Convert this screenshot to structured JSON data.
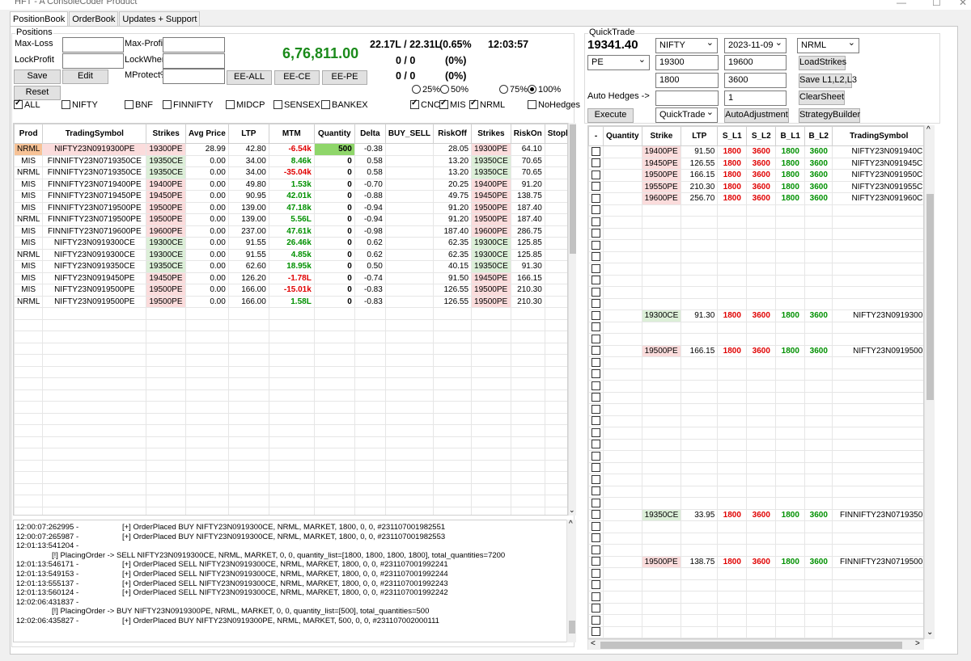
{
  "window": {
    "title": "HFT - A ConsoleCoder Product"
  },
  "tabs": [
    "PositionBook",
    "OrderBook",
    "Updates + Support"
  ],
  "positions": {
    "group_title": "Positions",
    "labels": {
      "max_loss": "Max-Loss",
      "max_profit": "Max-Profit",
      "lock_profit": "LockProfit",
      "lock_when": "LockWhen",
      "mprotect": "MProtect%"
    },
    "buttons": {
      "save": "Save",
      "edit": "Edit",
      "reset": "Reset",
      "ee_all": "EE-ALL",
      "ee_ce": "EE-CE",
      "ee_pe": "EE-PE"
    },
    "pnl": "6,76,811.00",
    "margin": "22.17L / 22.31L",
    "margin_pct": "(0.65%",
    "time": "12:03:57",
    "row1": "0 / 0",
    "row1_pct": "(0%)",
    "row2": "0 / 0",
    "row2_pct": "(0%)",
    "radios": [
      {
        "label": "25%",
        "on": false
      },
      {
        "label": "50%",
        "on": false
      },
      {
        "label": "75%",
        "on": false
      },
      {
        "label": "100%",
        "on": true
      }
    ],
    "filters": [
      {
        "label": "ALL",
        "on": true
      },
      {
        "label": "NIFTY",
        "on": false
      },
      {
        "label": "BNF",
        "on": false
      },
      {
        "label": "FINNIFTY",
        "on": false
      },
      {
        "label": "MIDCP",
        "on": false
      },
      {
        "label": "SENSEX",
        "on": false
      },
      {
        "label": "BANKEX",
        "on": false
      }
    ],
    "types": [
      {
        "label": "CNC",
        "on": true
      },
      {
        "label": "MIS",
        "on": true
      },
      {
        "label": "NRML",
        "on": true
      }
    ],
    "nohedges": {
      "label": "NoHedges",
      "on": false
    },
    "columns": [
      "Prod",
      "TradingSymbol",
      "Strikes",
      "Avg Price",
      "LTP",
      "MTM",
      "Quantity",
      "Delta",
      "BUY_SELL",
      "RiskOff",
      "Strikes",
      "RiskOn",
      "Stoploss"
    ],
    "rows": [
      [
        "NRML",
        "NIFTY23N0919300PE",
        "19300PE",
        "28.99",
        "42.80",
        "-6.54k",
        "500",
        "-0.38",
        "",
        "28.05",
        "19300PE",
        "64.10",
        ""
      ],
      [
        "MIS",
        "FINNIFTY23N0719350CE",
        "19350CE",
        "0.00",
        "34.00",
        "8.46k",
        "0",
        "0.58",
        "",
        "13.20",
        "19350CE",
        "70.65",
        ""
      ],
      [
        "NRML",
        "FINNIFTY23N0719350CE",
        "19350CE",
        "0.00",
        "34.00",
        "-35.04k",
        "0",
        "0.58",
        "",
        "13.20",
        "19350CE",
        "70.65",
        ""
      ],
      [
        "MIS",
        "FINNIFTY23N0719400PE",
        "19400PE",
        "0.00",
        "49.80",
        "1.53k",
        "0",
        "-0.70",
        "",
        "20.25",
        "19400PE",
        "91.20",
        ""
      ],
      [
        "MIS",
        "FINNIFTY23N0719450PE",
        "19450PE",
        "0.00",
        "90.95",
        "42.01k",
        "0",
        "-0.88",
        "",
        "49.75",
        "19450PE",
        "138.75",
        ""
      ],
      [
        "MIS",
        "FINNIFTY23N0719500PE",
        "19500PE",
        "0.00",
        "139.00",
        "47.18k",
        "0",
        "-0.94",
        "",
        "91.20",
        "19500PE",
        "187.40",
        ""
      ],
      [
        "NRML",
        "FINNIFTY23N0719500PE",
        "19500PE",
        "0.00",
        "139.00",
        "5.56L",
        "0",
        "-0.94",
        "",
        "91.20",
        "19500PE",
        "187.40",
        ""
      ],
      [
        "MIS",
        "FINNIFTY23N0719600PE",
        "19600PE",
        "0.00",
        "237.00",
        "47.61k",
        "0",
        "-0.98",
        "",
        "187.40",
        "19600PE",
        "286.75",
        ""
      ],
      [
        "MIS",
        "NIFTY23N0919300CE",
        "19300CE",
        "0.00",
        "91.55",
        "26.46k",
        "0",
        "0.62",
        "",
        "62.35",
        "19300CE",
        "125.85",
        ""
      ],
      [
        "NRML",
        "NIFTY23N0919300CE",
        "19300CE",
        "0.00",
        "91.55",
        "4.85k",
        "0",
        "0.62",
        "",
        "62.35",
        "19300CE",
        "125.85",
        ""
      ],
      [
        "MIS",
        "NIFTY23N0919350CE",
        "19350CE",
        "0.00",
        "62.60",
        "18.95k",
        "0",
        "0.50",
        "",
        "40.15",
        "19350CE",
        "91.30",
        ""
      ],
      [
        "MIS",
        "NIFTY23N0919450PE",
        "19450PE",
        "0.00",
        "126.20",
        "-1.78L",
        "0",
        "-0.74",
        "",
        "91.50",
        "19450PE",
        "166.15",
        ""
      ],
      [
        "MIS",
        "NIFTY23N0919500PE",
        "19500PE",
        "0.00",
        "166.00",
        "-15.01k",
        "0",
        "-0.83",
        "",
        "126.55",
        "19500PE",
        "210.30",
        ""
      ],
      [
        "NRML",
        "NIFTY23N0919500PE",
        "19500PE",
        "0.00",
        "166.00",
        "1.58L",
        "0",
        "-0.83",
        "",
        "126.55",
        "19500PE",
        "210.30",
        ""
      ]
    ],
    "log": [
      [
        "12:00:07:262995 -",
        "[+] OrderPlaced BUY NIFTY23N0919300CE, NRML, MARKET, 1800, 0, 0, #231107001982551"
      ],
      [
        "12:00:07:265987 -",
        "[+] OrderPlaced BUY NIFTY23N0919300CE, NRML, MARKET, 1800, 0, 0, #231107001982553"
      ],
      [
        "12:01:13:541204 -",
        ""
      ],
      [
        "",
        "[!] PlacingOrder -> SELL NIFTY23N0919300CE, NRML, MARKET, 0, 0, quantity_list=[1800, 1800, 1800, 1800], total_quantities=7200"
      ],
      [
        "12:01:13:546171 -",
        "[+] OrderPlaced SELL NIFTY23N0919300CE, NRML, MARKET, 1800, 0, 0, #231107001992241"
      ],
      [
        "12:01:13:549153 -",
        "[+] OrderPlaced SELL NIFTY23N0919300CE, NRML, MARKET, 1800, 0, 0, #231107001992244"
      ],
      [
        "12:01:13:555137 -",
        "[+] OrderPlaced SELL NIFTY23N0919300CE, NRML, MARKET, 1800, 0, 0, #231107001992243"
      ],
      [
        "12:01:13:560124 -",
        "[+] OrderPlaced SELL NIFTY23N0919300CE, NRML, MARKET, 1800, 0, 0, #231107001992242"
      ],
      [
        "12:02:06:431837 -",
        ""
      ],
      [
        "",
        "[!] PlacingOrder -> BUY NIFTY23N0919300PE, NRML, MARKET, 0, 0, quantity_list=[500], total_quantities=500"
      ],
      [
        "12:02:06:435827 -",
        "[+] OrderPlaced BUY NIFTY23N0919300PE, NRML, MARKET, 500, 0, 0, #231107002000111"
      ]
    ]
  },
  "quicktrade": {
    "group_title": "QuickTrade",
    "spot": "19341.40",
    "index": "NIFTY",
    "expiry": "2023-11-09",
    "product": "NRML",
    "opt_type": "PE",
    "from_strike": "19300",
    "to_strike": "19600",
    "qty1": "1800",
    "qty2": "3600",
    "auto_hedges_label": "Auto Hedges ->",
    "auto_hedges_val": "",
    "auto_hedges_num": "1",
    "buttons": {
      "load": "LoadStrikes",
      "save_l": "Save L1,L2,L3",
      "clear": "ClearSheet",
      "execute": "Execute",
      "auto_adj": "AutoAdjustment",
      "strategy": "StrategyBuilder"
    },
    "mode": "QuickTrade",
    "columns": [
      "-",
      "Quantity",
      "Strike",
      "LTP",
      "S_L1",
      "S_L2",
      "B_L1",
      "B_L2",
      "TradingSymbol"
    ],
    "rows": [
      {
        "strike": "19400PE",
        "ltp": "91.50",
        "s1": "1800",
        "s2": "3600",
        "b1": "1800",
        "b2": "3600",
        "sym": "NIFTY23N091940C"
      },
      {
        "strike": "19450PE",
        "ltp": "126.55",
        "s1": "1800",
        "s2": "3600",
        "b1": "1800",
        "b2": "3600",
        "sym": "NIFTY23N091945C"
      },
      {
        "strike": "19500PE",
        "ltp": "166.15",
        "s1": "1800",
        "s2": "3600",
        "b1": "1800",
        "b2": "3600",
        "sym": "NIFTY23N091950C"
      },
      {
        "strike": "19550PE",
        "ltp": "210.30",
        "s1": "1800",
        "s2": "3600",
        "b1": "1800",
        "b2": "3600",
        "sym": "NIFTY23N091955C"
      },
      {
        "strike": "19600PE",
        "ltp": "256.70",
        "s1": "1800",
        "s2": "3600",
        "b1": "1800",
        "b2": "3600",
        "sym": "NIFTY23N091960C"
      },
      {
        "gap": true
      },
      {
        "gap": true
      },
      {
        "gap": true
      },
      {
        "gap": true
      },
      {
        "gap": true
      },
      {
        "gap": true
      },
      {
        "gap": true
      },
      {
        "gap": true
      },
      {
        "gap": true
      },
      {
        "strike": "19300CE",
        "ltp": "91.30",
        "s1": "1800",
        "s2": "3600",
        "b1": "1800",
        "b2": "3600",
        "sym": "NIFTY23N0919300"
      },
      {
        "gap": true
      },
      {
        "gap": true
      },
      {
        "strike": "19500PE",
        "ltp": "166.15",
        "s1": "1800",
        "s2": "3600",
        "b1": "1800",
        "b2": "3600",
        "sym": "NIFTY23N0919500"
      },
      {
        "gap": true
      },
      {
        "gap": true
      },
      {
        "gap": true
      },
      {
        "gap": true
      },
      {
        "gap": true
      },
      {
        "gap": true
      },
      {
        "gap": true
      },
      {
        "gap": true
      },
      {
        "gap": true
      },
      {
        "gap": true
      },
      {
        "gap": true
      },
      {
        "gap": true
      },
      {
        "gap": true
      },
      {
        "strike": "19350CE",
        "ltp": "33.95",
        "s1": "1800",
        "s2": "3600",
        "b1": "1800",
        "b2": "3600",
        "sym": "FINNIFTY23N0719350"
      },
      {
        "gap": true
      },
      {
        "gap": true
      },
      {
        "gap": true
      },
      {
        "strike": "19500PE",
        "ltp": "138.75",
        "s1": "1800",
        "s2": "3600",
        "b1": "1800",
        "b2": "3600",
        "sym": "FINNIFTY23N0719500"
      },
      {
        "gap": true
      },
      {
        "gap": true
      },
      {
        "gap": true
      },
      {
        "gap": true
      },
      {
        "gap": true
      },
      {
        "gap": true
      },
      {
        "gap": true
      }
    ]
  }
}
